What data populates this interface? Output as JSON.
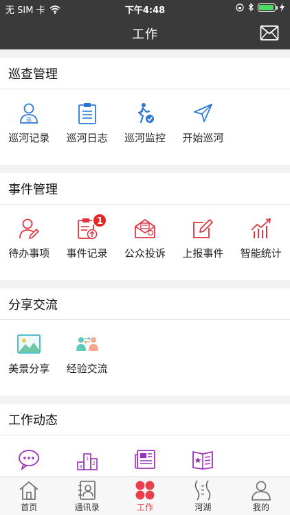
{
  "status_bar": {
    "carrier": "无 SIM 卡",
    "time": "下午4:48",
    "battery_level": 0.95
  },
  "navbar": {
    "title": "工作",
    "mail_icon": "mail-icon"
  },
  "sections": [
    {
      "title": "巡查管理",
      "items": [
        {
          "label": "巡河记录",
          "icon": "patrol-person-icon",
          "icon_glyph": "巡"
        },
        {
          "label": "巡河日志",
          "icon": "clipboard-log-icon"
        },
        {
          "label": "巡河监控",
          "icon": "walking-person-check-icon"
        },
        {
          "label": "开始巡河",
          "icon": "navigation-arrow-icon"
        }
      ]
    },
    {
      "title": "事件管理",
      "items": [
        {
          "label": "待办事项",
          "icon": "person-edit-icon"
        },
        {
          "label": "事件记录",
          "icon": "clipboard-upload-icon",
          "badge": "1"
        },
        {
          "label": "公众投诉",
          "icon": "envelope-complaint-icon"
        },
        {
          "label": "上报事件",
          "icon": "edit-square-icon"
        },
        {
          "label": "智能统计",
          "icon": "bar-chart-trend-icon"
        }
      ]
    },
    {
      "title": "分享交流",
      "items": [
        {
          "label": "美景分享",
          "icon": "landscape-picture-icon"
        },
        {
          "label": "经验交流",
          "icon": "people-exchange-icon"
        }
      ]
    },
    {
      "title": "工作动态",
      "items": [
        {
          "label": "",
          "icon": "chat-bubble-icon"
        },
        {
          "label": "",
          "icon": "podium-ranking-icon",
          "podium_labels": [
            "3",
            "1",
            "2"
          ]
        },
        {
          "label": "",
          "icon": "newspaper-icon"
        },
        {
          "label": "",
          "icon": "star-book-icon"
        }
      ]
    }
  ],
  "tabbar": {
    "items": [
      {
        "label": "首页",
        "icon": "home-icon",
        "active": false
      },
      {
        "label": "通讯录",
        "icon": "contacts-icon",
        "active": false
      },
      {
        "label": "工作",
        "icon": "work-grid-icon",
        "active": true
      },
      {
        "label": "河湖",
        "icon": "river-icon",
        "active": false
      },
      {
        "label": "我的",
        "icon": "profile-icon",
        "active": false
      }
    ]
  },
  "colors": {
    "header_bg": "#3a3a3a",
    "patrol_blue": "#2b77d6",
    "event_red": "#e0333f",
    "share_teal": "#3fb8c8",
    "dynamic_purple": "#9b2fbf",
    "active_tab": "#e8404d"
  }
}
